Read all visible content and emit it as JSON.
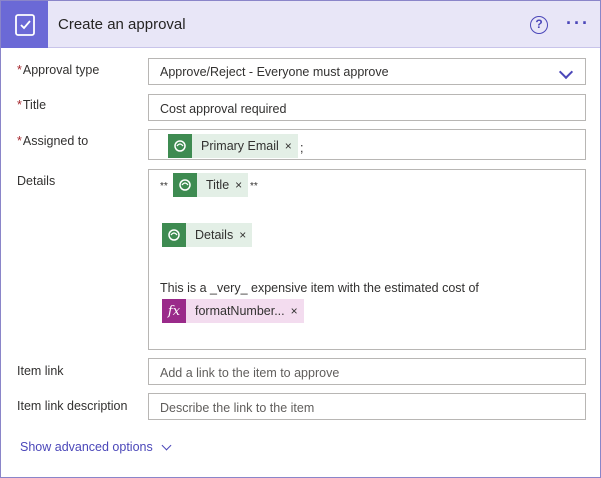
{
  "header": {
    "title": "Create an approval",
    "help_glyph": "?",
    "more_glyph": "···",
    "accent_color": "#6b69d6"
  },
  "fields": {
    "approval_type": {
      "label": "Approval type",
      "required_mark": "*",
      "value": "Approve/Reject - Everyone must approve"
    },
    "title": {
      "label": "Title",
      "required_mark": "*",
      "value": "Cost approval required"
    },
    "assigned_to": {
      "label": "Assigned to",
      "required_mark": "*",
      "token": "Primary Email",
      "separator": ";"
    },
    "details": {
      "label": "Details",
      "bold_marker_open": "**",
      "bold_marker_close": "**",
      "token_title": "Title",
      "token_details": "Details",
      "body_text": "This is a _very_ expensive item with the estimated cost of",
      "fx_token": "formatNumber...",
      "fx_glyph": "fx"
    },
    "item_link": {
      "label": "Item link",
      "placeholder": "Add a link to the item to approve"
    },
    "item_link_description": {
      "label": "Item link description",
      "placeholder": "Describe the link to the item"
    }
  },
  "token_remove_glyph": "×",
  "advanced_options": "Show advanced options",
  "icons": {
    "app": "approval-icon",
    "token": "dataverse-icon",
    "expression": "fx-icon"
  }
}
